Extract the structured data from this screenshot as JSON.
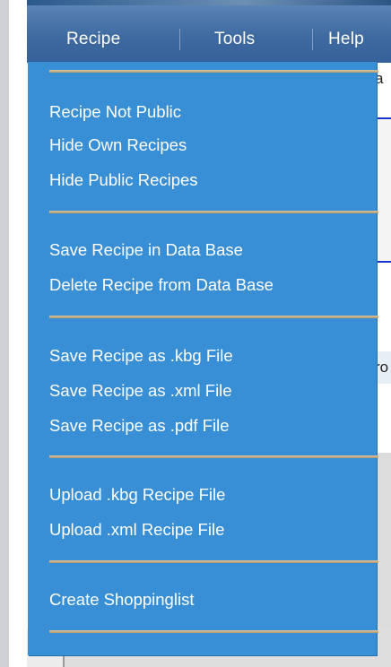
{
  "menubar": {
    "items": [
      {
        "label": "Recipe"
      },
      {
        "label": "Tools"
      },
      {
        "label": "Help"
      }
    ]
  },
  "background": {
    "fragments": [
      "a",
      "ro"
    ]
  },
  "dropdown": {
    "groups": [
      {
        "items": [
          "Recipe Not Public",
          "Hide Own Recipes",
          "Hide Public Recipes"
        ]
      },
      {
        "items": [
          "Save Recipe in Data Base",
          "Delete Recipe from Data Base"
        ]
      },
      {
        "items": [
          "Save Recipe as .kbg File",
          "Save Recipe as .xml File",
          "Save Recipe as .pdf File"
        ]
      },
      {
        "items": [
          "Upload .kbg Recipe File",
          "Upload .xml Recipe File"
        ]
      },
      {
        "items": [
          "Create Shoppinglist"
        ]
      }
    ]
  }
}
